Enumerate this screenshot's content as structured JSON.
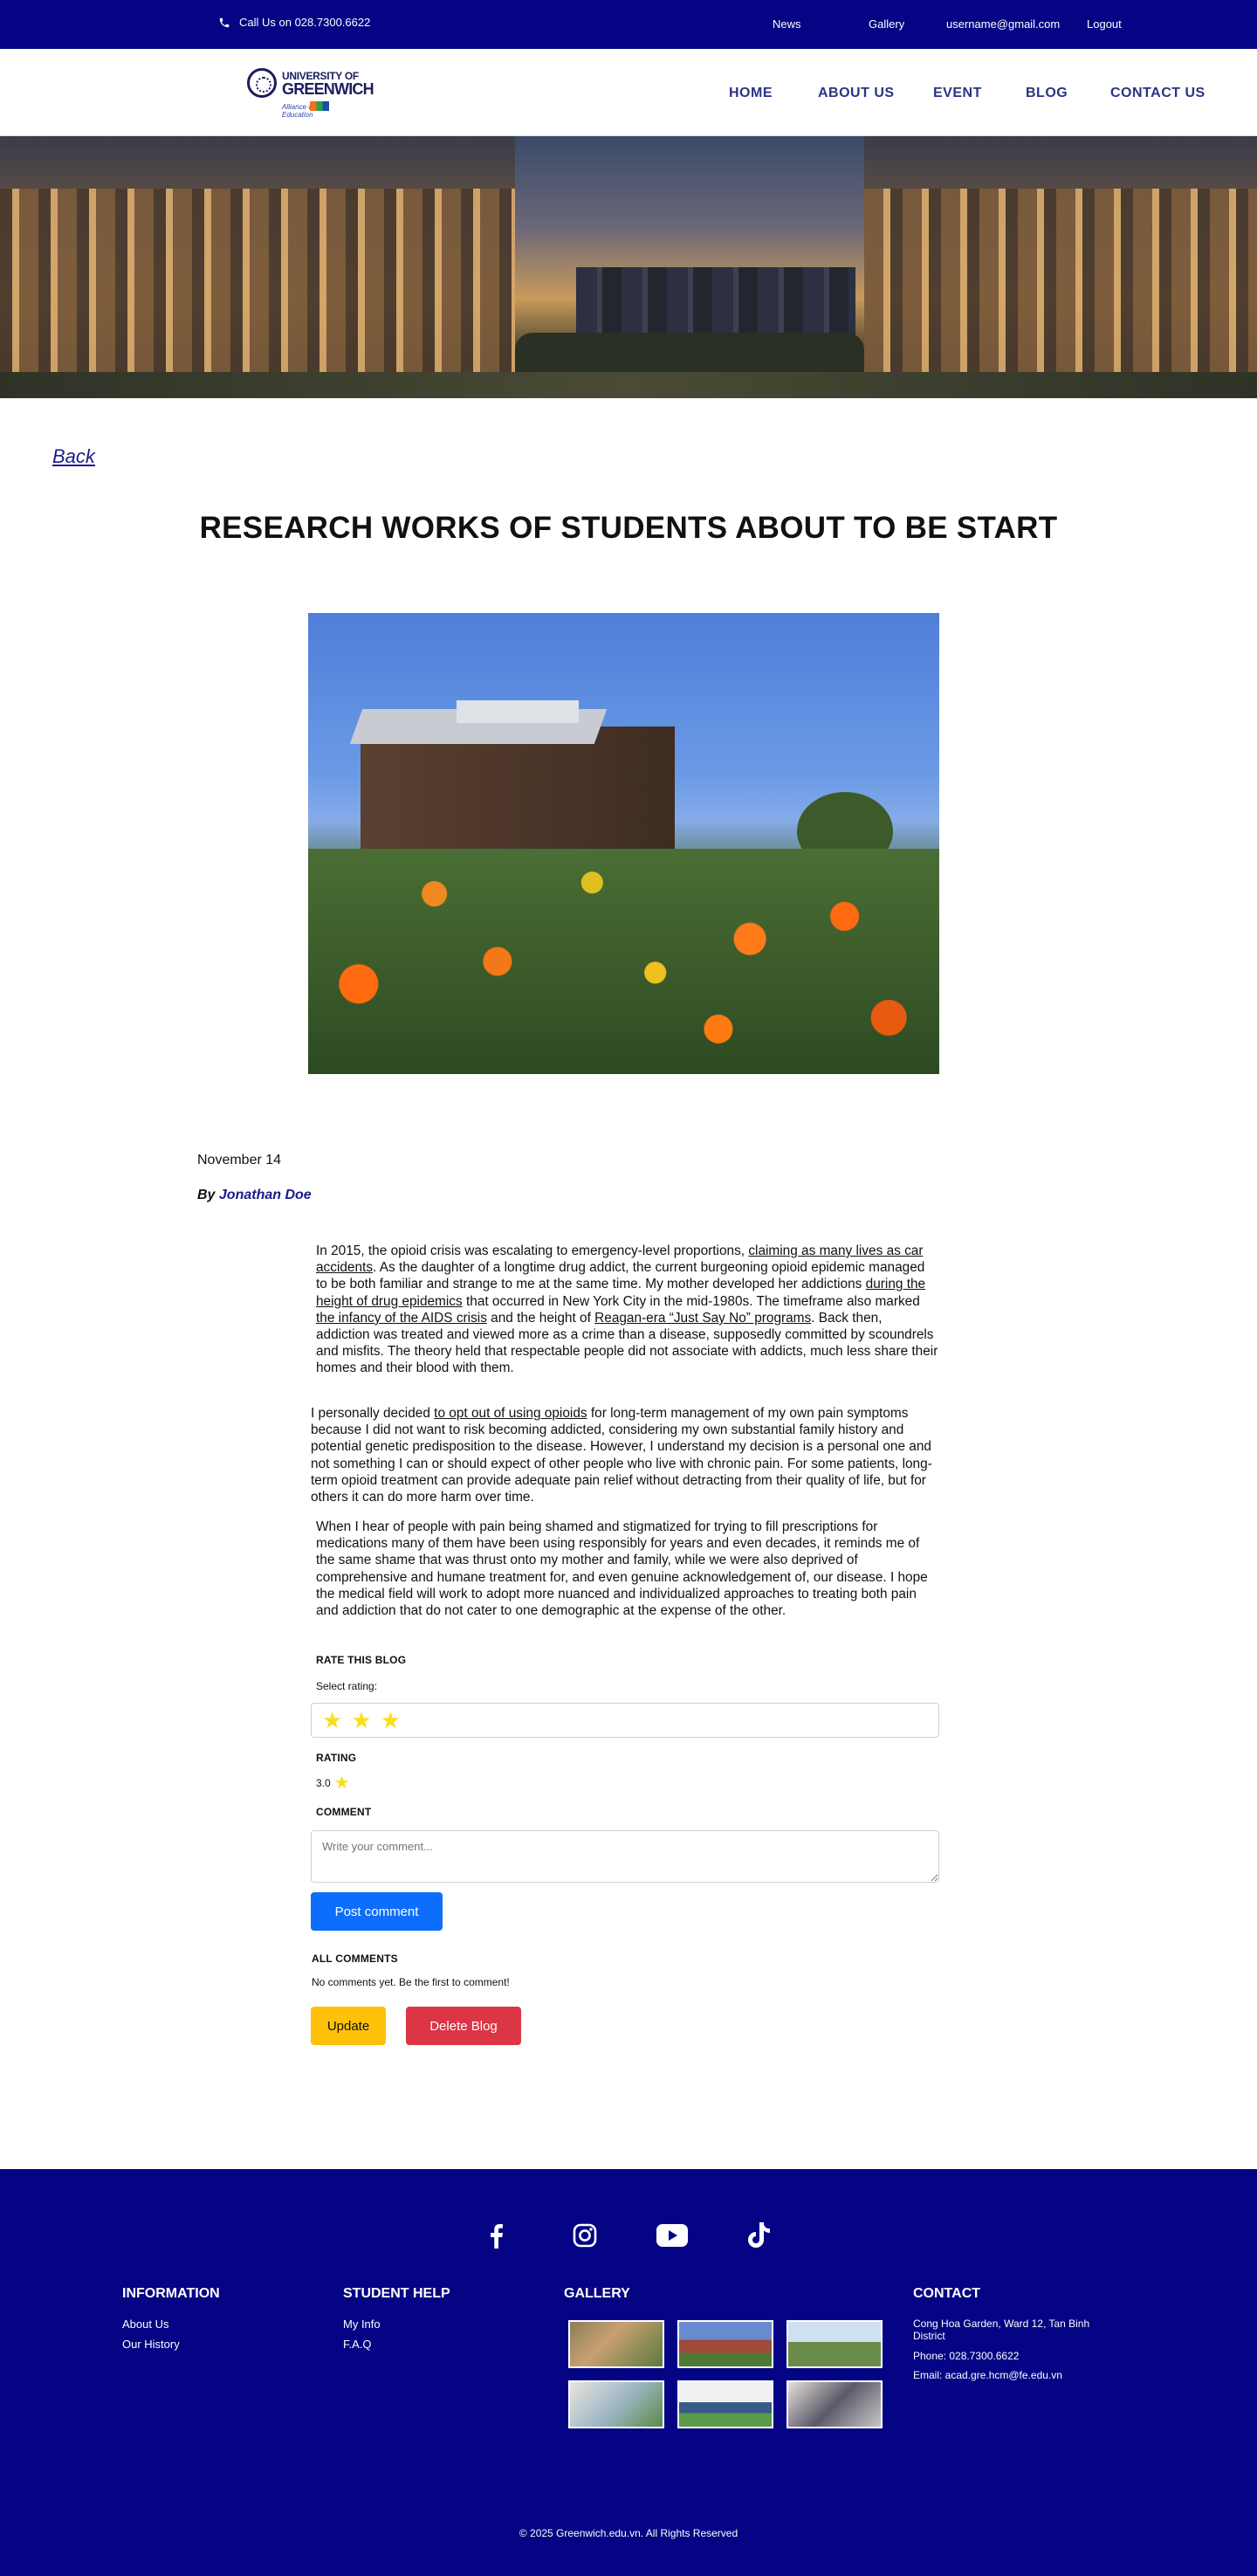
{
  "topbar": {
    "phone": "Call Us on 028.7300.6622",
    "news": "News",
    "gallery": "Gallery",
    "email": "username@gmail.com",
    "logout": "Logout"
  },
  "brand": {
    "line1": "UNIVERSITY OF",
    "line2": "GREENWICH",
    "tagline": "Alliance with",
    "tagline2": "Education"
  },
  "nav": {
    "home": "HOME",
    "about": "ABOUT US",
    "event": "EVENT",
    "blog": "BLOG",
    "contact": "CONTACT US"
  },
  "page": {
    "back": "Back",
    "title": "RESEARCH WORKS OF STUDENTS ABOUT TO BE START",
    "date": "November 14",
    "by": "By",
    "author": "Jonathan Doe"
  },
  "article": {
    "p1": [
      {
        "t": "In 2015, the opioid crisis was escalating to emergency-level proportions, "
      },
      {
        "t": "claiming as many lives as car accidents",
        "u": true
      },
      {
        "t": ".  As the daughter of a longtime drug addict, the current burgeoning opioid epidemic managed to be both familiar and strange to me at the same time. My mother developed her addictions "
      },
      {
        "t": "during the height of drug epidemics",
        "u": true
      },
      {
        "t": " that occurred in New York City in the mid-1980s. The timeframe also marked "
      },
      {
        "t": "the infancy of the AIDS crisis",
        "u": true
      },
      {
        "t": " and the height of "
      },
      {
        "t": "Reagan-era “Just Say No” programs",
        "u": true
      },
      {
        "t": ". Back then, addiction was treated and viewed more as a crime than a disease, supposedly committed by scoundrels and misfits. The theory held that respectable people did not associate with addicts, much less share their homes and their blood with them."
      }
    ],
    "p2": [
      {
        "t": "I personally decided "
      },
      {
        "t": "to opt out of using opioids",
        "u": true
      },
      {
        "t": " for long-term management of my own pain symptoms because I did not want to risk becoming addicted, considering my own substantial family history and potential genetic predisposition to the disease. However, I understand my decision is a personal one and not something I can or should expect of other people who live with chronic pain. For some patients, long-term opioid treatment can provide adequate pain relief without detracting from their quality of life, but for others it can do more harm over time."
      }
    ],
    "p3": [
      {
        "t": "When I hear of people with pain being shamed and stigmatized for trying to fill prescriptions for medications many of them have been using responsibly for years and even decades, it reminds me of the same shame that was thrust onto my mother and family, while we were also deprived of comprehensive and humane treatment for, and even genuine acknowledgement of, our disease. I hope the medical field will work to adopt more nuanced and individualized approaches to treating both pain and addiction that do not cater to one demographic at the expense of the other."
      }
    ]
  },
  "rating": {
    "heading": "RATE THIS BLOG",
    "select_label": "Select rating:",
    "stars_selected": 3,
    "star_glyph": "★",
    "avg_heading": "RATING",
    "avg_value": "3.0"
  },
  "comment": {
    "heading": "COMMENT",
    "placeholder": "Write your comment...",
    "post": "Post comment",
    "all_heading": "ALL COMMENTS",
    "empty": "No comments yet. Be the first to comment!"
  },
  "actions": {
    "update": "Update",
    "delete": "Delete Blog"
  },
  "footer": {
    "social_icons": [
      "facebook-icon",
      "instagram-icon",
      "youtube-icon",
      "tiktok-icon"
    ],
    "info_h": "INFORMATION",
    "info_links": [
      "About Us",
      "Our History"
    ],
    "help_h": "STUDENT HELP",
    "help_links": [
      "My Info",
      "F.A.Q"
    ],
    "gallery_h": "GALLERY",
    "contact_h": "CONTACT",
    "address": "Cong Hoa Garden, Ward 12, Tan Binh District",
    "phone": "Phone: 028.7300.6622",
    "email": "Email: acad.gre.hcm@fe.edu.vn",
    "copyright": "© 2025 Greenwich.edu.vn. All Rights Reserved"
  },
  "colors": {
    "brand_navy": "#040484",
    "nav_text": "#2a3484",
    "post_button": "#0d6efd",
    "update_button": "#ffc107",
    "delete_button": "#dc3545",
    "star": "#f7e01a"
  }
}
